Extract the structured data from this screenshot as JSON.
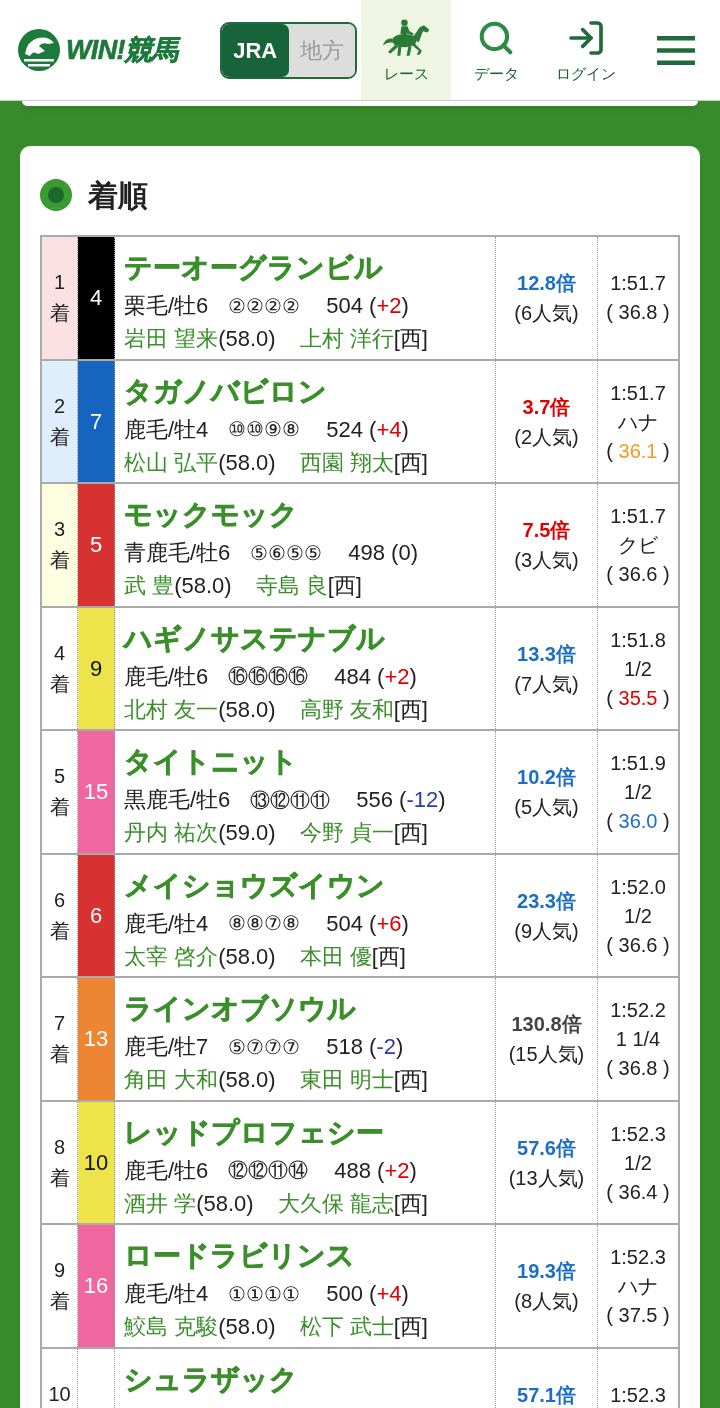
{
  "header": {
    "logo_text": "WIN!競馬",
    "league_tabs": [
      {
        "label": "JRA",
        "selected": true
      },
      {
        "label": "地方",
        "selected": false
      }
    ],
    "nav": [
      {
        "label": "レース",
        "selected": true
      },
      {
        "label": "データ",
        "selected": false
      },
      {
        "label": "ログイン",
        "selected": false
      }
    ]
  },
  "results": {
    "title": "着順",
    "rows": [
      {
        "rank": {
          "text": "1",
          "unit": "着",
          "color": "#fbe1e2"
        },
        "frame": {
          "number": "4",
          "color": "#000000"
        },
        "name": "テーオーグランビル",
        "coat_sex_age": "栗毛/牡6",
        "corners": "②②②②",
        "weight": "504",
        "weight_change": {
          "open": "(",
          "value": "+2",
          "close": ")",
          "color": "#e00000"
        },
        "jockey": "岩田 望来",
        "jockey_weight": "(58.0)",
        "trainer": "上村 洋行",
        "trainer_region": "[西]",
        "odds": {
          "text": "12.8倍",
          "color": "#1a6fc4"
        },
        "popularity": "(6人気)",
        "time": "1:51.7",
        "last_3f": {
          "open": "(",
          "value": "36.8",
          "close": ")"
        }
      },
      {
        "rank": {
          "text": "2",
          "unit": "着",
          "color": "#dfeefc"
        },
        "frame": {
          "number": "7",
          "color": "#1565c0"
        },
        "name": "タガノバビロン",
        "coat_sex_age": "鹿毛/牡4",
        "corners": "⑩⑩⑨⑧",
        "weight": "524",
        "weight_change": {
          "open": "(",
          "value": "+4",
          "close": ")",
          "color": "#e00000"
        },
        "jockey": "松山 弘平",
        "jockey_weight": "(58.0)",
        "trainer": "西園 翔太",
        "trainer_region": "[西]",
        "odds": {
          "text": "3.7倍",
          "color": "#e00000"
        },
        "popularity": "(2人気)",
        "time": "1:51.7",
        "margin": "ハナ",
        "last_3f": {
          "open": "(",
          "value": "36.1",
          "close": ")",
          "color": "#f39a1e"
        }
      },
      {
        "rank": {
          "text": "3",
          "unit": "着",
          "color": "#fdfde0"
        },
        "frame": {
          "number": "5",
          "color": "#d63232"
        },
        "name": "モックモック",
        "coat_sex_age": "青鹿毛/牡6",
        "corners": "⑤⑥⑤⑤",
        "weight": "498",
        "weight_change": {
          "open": "(",
          "value": "0",
          "close": ")"
        },
        "jockey": "武 豊",
        "jockey_weight": "(58.0)",
        "trainer": "寺島 良",
        "trainer_region": "[西]",
        "odds": {
          "text": "7.5倍",
          "color": "#e00000"
        },
        "popularity": "(3人気)",
        "time": "1:51.7",
        "margin": "クビ",
        "last_3f": {
          "open": "(",
          "value": "36.6",
          "close": ")"
        }
      },
      {
        "rank": {
          "text": "4",
          "unit": "着"
        },
        "frame": {
          "number": "9",
          "color": "#ede44b"
        },
        "name": "ハギノサステナブル",
        "coat_sex_age": "鹿毛/牡6",
        "corners": "⑯⑯⑯⑯",
        "weight": "484",
        "weight_change": {
          "open": "(",
          "value": "+2",
          "close": ")",
          "color": "#e00000"
        },
        "jockey": "北村 友一",
        "jockey_weight": "(58.0)",
        "trainer": "高野 友和",
        "trainer_region": "[西]",
        "odds": {
          "text": "13.3倍",
          "color": "#1a6fc4"
        },
        "popularity": "(7人気)",
        "time": "1:51.8",
        "margin": "1/2",
        "last_3f": {
          "open": "(",
          "value": "35.5",
          "close": ")",
          "color": "#e00000"
        }
      },
      {
        "rank": {
          "text": "5",
          "unit": "着"
        },
        "frame": {
          "number": "15",
          "color": "#f0669e"
        },
        "name": "タイトニット",
        "coat_sex_age": "黒鹿毛/牡6",
        "corners": "⑬⑫⑪⑪",
        "weight": "556",
        "weight_change": {
          "open": "(",
          "value": "-12",
          "close": ")",
          "color": "#2a3bb0"
        },
        "jockey": "丹内 祐次",
        "jockey_weight": "(59.0)",
        "trainer": "今野 貞一",
        "trainer_region": "[西]",
        "odds": {
          "text": "10.2倍",
          "color": "#1a6fc4"
        },
        "popularity": "(5人気)",
        "time": "1:51.9",
        "margin": "1/2",
        "last_3f": {
          "open": "(",
          "value": "36.0",
          "close": ")",
          "color": "#1a6fc4"
        }
      },
      {
        "rank": {
          "text": "6",
          "unit": "着"
        },
        "frame": {
          "number": "6",
          "color": "#d63232"
        },
        "name": "メイショウズイウン",
        "coat_sex_age": "鹿毛/牡4",
        "corners": "⑧⑧⑦⑧",
        "weight": "504",
        "weight_change": {
          "open": "(",
          "value": "+6",
          "close": ")",
          "color": "#e00000"
        },
        "jockey": "太宰 啓介",
        "jockey_weight": "(58.0)",
        "trainer": "本田 優",
        "trainer_region": "[西]",
        "odds": {
          "text": "23.3倍",
          "color": "#1a6fc4"
        },
        "popularity": "(9人気)",
        "time": "1:52.0",
        "margin": "1/2",
        "last_3f": {
          "open": "(",
          "value": "36.6",
          "close": ")"
        }
      },
      {
        "rank": {
          "text": "7",
          "unit": "着"
        },
        "frame": {
          "number": "13",
          "color": "#ee8532"
        },
        "name": "ラインオブソウル",
        "coat_sex_age": "鹿毛/牡7",
        "corners": "⑤⑦⑦⑦",
        "weight": "518",
        "weight_change": {
          "open": "(",
          "value": "-2",
          "close": ")",
          "color": "#2a3bb0"
        },
        "jockey": "角田 大和",
        "jockey_weight": "(58.0)",
        "trainer": "東田 明士",
        "trainer_region": "[西]",
        "odds": {
          "text": "130.8倍",
          "color": "#444444"
        },
        "popularity": "(15人気)",
        "time": "1:52.2",
        "margin": "1 1/4",
        "last_3f": {
          "open": "(",
          "value": "36.8",
          "close": ")"
        }
      },
      {
        "rank": {
          "text": "8",
          "unit": "着"
        },
        "frame": {
          "number": "10",
          "color": "#ede44b"
        },
        "name": "レッドプロフェシー",
        "coat_sex_age": "鹿毛/牡6",
        "corners": "⑫⑫⑪⑭",
        "weight": "488",
        "weight_change": {
          "open": "(",
          "value": "+2",
          "close": ")",
          "color": "#e00000"
        },
        "jockey": "酒井 学",
        "jockey_weight": "(58.0)",
        "trainer": "大久保 龍志",
        "trainer_region": "[西]",
        "odds": {
          "text": "57.6倍",
          "color": "#1a6fc4"
        },
        "popularity": "(13人気)",
        "time": "1:52.3",
        "margin": "1/2",
        "last_3f": {
          "open": "(",
          "value": "36.4",
          "close": ")"
        }
      },
      {
        "rank": {
          "text": "9",
          "unit": "着"
        },
        "frame": {
          "number": "16",
          "color": "#f0669e"
        },
        "name": "ロードラビリンス",
        "coat_sex_age": "鹿毛/牡4",
        "corners": "①①①①",
        "weight": "500",
        "weight_change": {
          "open": "(",
          "value": "+4",
          "close": ")",
          "color": "#e00000"
        },
        "jockey": "鮫島 克駿",
        "jockey_weight": "(58.0)",
        "trainer": "松下 武士",
        "trainer_region": "[西]",
        "odds": {
          "text": "19.3倍",
          "color": "#1a6fc4"
        },
        "popularity": "(8人気)",
        "time": "1:52.3",
        "margin": "ハナ",
        "last_3f": {
          "open": "(",
          "value": "37.5",
          "close": ")"
        }
      },
      {
        "rank": {
          "text": "10"
        },
        "frame": {
          "color": "#ffffff"
        },
        "name": "シュラザック",
        "odds": {
          "text": "57.1倍",
          "color": "#1a6fc4"
        },
        "time": "1:52.3"
      }
    ]
  }
}
